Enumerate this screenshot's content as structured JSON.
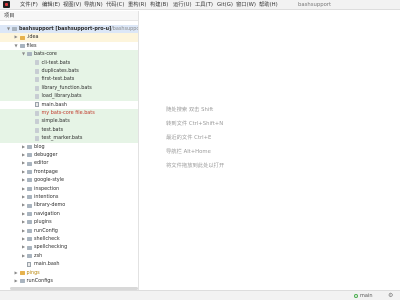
{
  "window": {
    "title": "bashsupport"
  },
  "menu": [
    "文件(F)",
    "编辑(E)",
    "视图(V)",
    "导航(N)",
    "代码(C)",
    "重构(R)",
    "构建(B)",
    "运行(U)",
    "工具(T)",
    "Git(G)",
    "窗口(W)",
    "帮助(H)"
  ],
  "project_panel": {
    "title": "项目"
  },
  "tree": [
    {
      "label": "bashsupport [bashsupport-pro-u]",
      "suffix": "~/bashsupport",
      "depth": 0,
      "expanded": true,
      "icon": "project-folder-icon",
      "style": "root"
    },
    {
      "label": ".idea",
      "depth": 1,
      "expanded": false,
      "icon": "folder-icon",
      "style": "yellow"
    },
    {
      "label": "files",
      "depth": 1,
      "expanded": true,
      "icon": "folder-icon",
      "style": ""
    },
    {
      "label": "bats-core",
      "depth": 2,
      "expanded": true,
      "icon": "folder-icon",
      "style": "green"
    },
    {
      "label": "cli-test.bats",
      "depth": 3,
      "icon": "script-icon",
      "style": "green"
    },
    {
      "label": "duplicates.bats",
      "depth": 3,
      "icon": "script-icon",
      "style": "green"
    },
    {
      "label": "first-test.bats",
      "depth": 3,
      "icon": "script-icon",
      "style": "green"
    },
    {
      "label": "library_function.bats",
      "depth": 3,
      "icon": "script-icon",
      "style": "green"
    },
    {
      "label": "load_library.bats",
      "depth": 3,
      "icon": "script-icon",
      "style": "green"
    },
    {
      "label": "main.bash",
      "depth": 3,
      "icon": "file-icon",
      "style": ""
    },
    {
      "label": "my bats-core file.bats",
      "depth": 3,
      "icon": "script-icon",
      "style": "green-red"
    },
    {
      "label": "simple.bats",
      "depth": 3,
      "icon": "script-icon",
      "style": "green"
    },
    {
      "label": "test.bats",
      "depth": 3,
      "icon": "script-icon",
      "style": "green"
    },
    {
      "label": "test_marker.bats",
      "depth": 3,
      "icon": "script-icon",
      "style": "green"
    },
    {
      "label": "blog",
      "depth": 2,
      "expanded": false,
      "icon": "folder-icon",
      "style": ""
    },
    {
      "label": "debugger",
      "depth": 2,
      "expanded": false,
      "icon": "folder-icon",
      "style": ""
    },
    {
      "label": "editor",
      "depth": 2,
      "expanded": false,
      "icon": "folder-icon",
      "style": ""
    },
    {
      "label": "frontpage",
      "depth": 2,
      "expanded": false,
      "icon": "folder-icon",
      "style": ""
    },
    {
      "label": "google-style",
      "depth": 2,
      "expanded": false,
      "icon": "folder-icon",
      "style": ""
    },
    {
      "label": "inspection",
      "depth": 2,
      "expanded": false,
      "icon": "folder-icon",
      "style": ""
    },
    {
      "label": "intentions",
      "depth": 2,
      "expanded": false,
      "icon": "folder-icon",
      "style": ""
    },
    {
      "label": "library-demo",
      "depth": 2,
      "expanded": false,
      "icon": "folder-icon",
      "style": ""
    },
    {
      "label": "navigation",
      "depth": 2,
      "expanded": false,
      "icon": "folder-icon",
      "style": ""
    },
    {
      "label": "plugins",
      "depth": 2,
      "expanded": false,
      "icon": "folder-icon",
      "style": ""
    },
    {
      "label": "runConfig",
      "depth": 2,
      "expanded": false,
      "icon": "folder-icon",
      "style": ""
    },
    {
      "label": "shellcheck",
      "depth": 2,
      "expanded": false,
      "icon": "folder-icon",
      "style": ""
    },
    {
      "label": "spellchecking",
      "depth": 2,
      "expanded": false,
      "icon": "folder-icon",
      "style": ""
    },
    {
      "label": "zsh",
      "depth": 2,
      "expanded": false,
      "icon": "folder-icon",
      "style": ""
    },
    {
      "label": "main.bash",
      "depth": 2,
      "icon": "file-icon",
      "style": ""
    },
    {
      "label": "pings",
      "depth": 1,
      "expanded": false,
      "icon": "folder-icon",
      "style": "excluded"
    },
    {
      "label": "runConfigs",
      "depth": 1,
      "expanded": false,
      "icon": "folder-icon",
      "style": ""
    }
  ],
  "editor_hints": [
    "随处搜索 双击 Shift",
    "转到文件 Ctrl+Shift+N",
    "最近的文件 Ctrl+E",
    "导航栏 Alt+Home",
    "将文件拖放到此处以打开"
  ],
  "status": {
    "branch": "main"
  },
  "colors": {
    "green_row": "#e6f4e6",
    "yellow_row": "#fdf5dc",
    "red_text": "#c0392b"
  }
}
